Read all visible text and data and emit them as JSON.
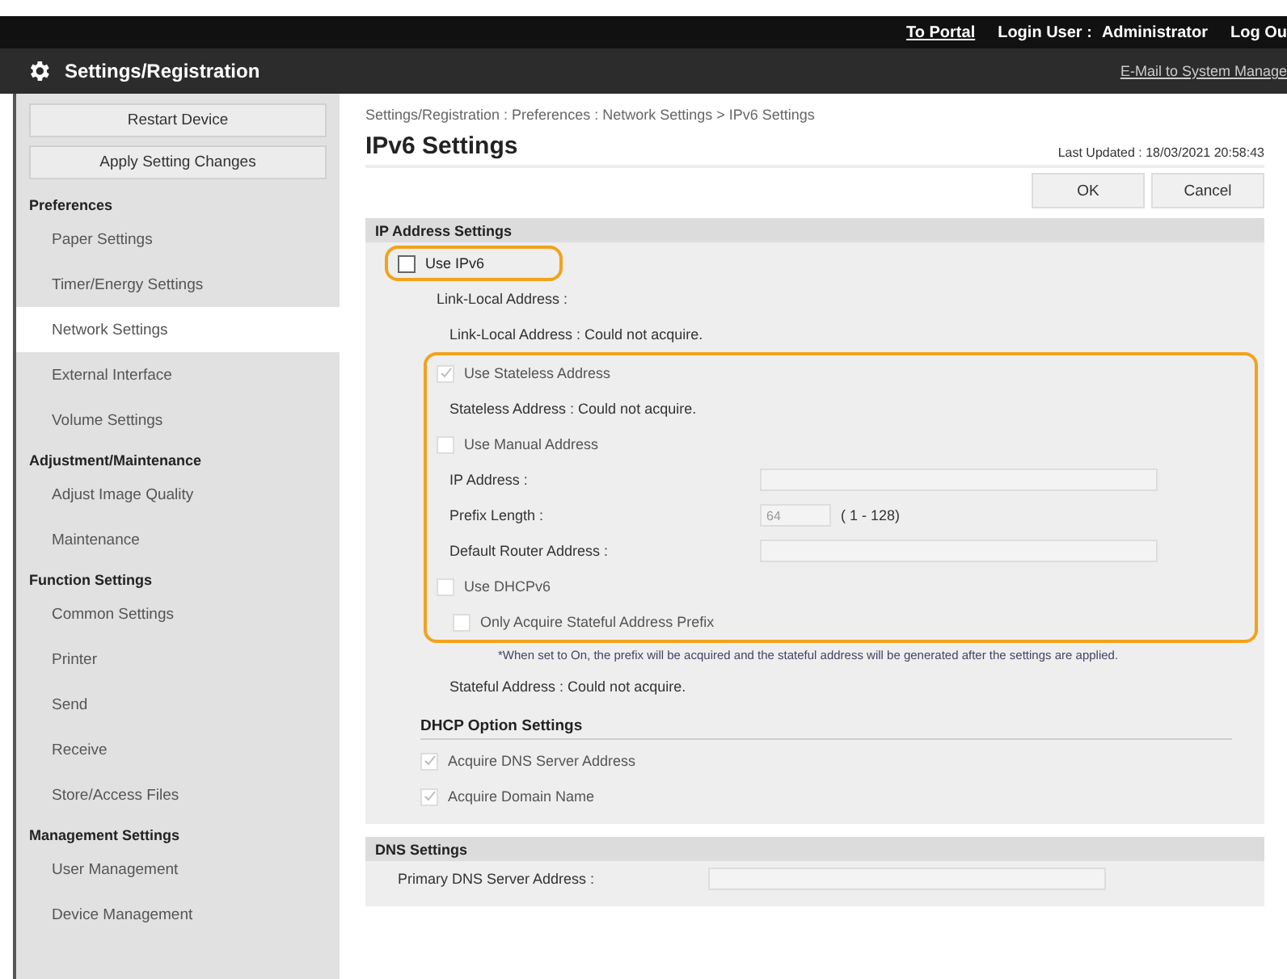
{
  "top_bar": {
    "links": [
      "To Portal"
    ],
    "login_label": "Login User :",
    "user": "Administrator",
    "logout": "Log Ou"
  },
  "header": {
    "title": "Settings/Registration",
    "mail_link": "E-Mail to System Manage"
  },
  "sidebar": {
    "buttons": [
      "Restart Device",
      "Apply Setting Changes"
    ],
    "groups": [
      {
        "title": "Preferences",
        "items": [
          {
            "label": "Paper Settings",
            "selected": false
          },
          {
            "label": "Timer/Energy Settings",
            "selected": false
          },
          {
            "label": "Network Settings",
            "selected": true
          },
          {
            "label": "External Interface",
            "selected": false
          },
          {
            "label": "Volume Settings",
            "selected": false
          }
        ]
      },
      {
        "title": "Adjustment/Maintenance",
        "items": [
          {
            "label": "Adjust Image Quality",
            "selected": false
          },
          {
            "label": "Maintenance",
            "selected": false
          }
        ]
      },
      {
        "title": "Function Settings",
        "items": [
          {
            "label": "Common Settings",
            "selected": false
          },
          {
            "label": "Printer",
            "selected": false
          },
          {
            "label": "Send",
            "selected": false
          },
          {
            "label": "Receive",
            "selected": false
          },
          {
            "label": "Store/Access Files",
            "selected": false
          }
        ]
      },
      {
        "title": "Management Settings",
        "items": [
          {
            "label": "User Management",
            "selected": false
          },
          {
            "label": "Device Management",
            "selected": false
          }
        ]
      }
    ]
  },
  "breadcrumb": "Settings/Registration : Preferences : Network Settings > IPv6 Settings",
  "page_title": "IPv6 Settings",
  "last_updated": "Last Updated : 18/03/2021 20:58:43",
  "buttons": [
    "OK",
    "Cancel"
  ],
  "ip_address_settings": {
    "title": "IP Address Settings",
    "use_ipv6": {
      "label": "Use IPv6",
      "checked": false,
      "disabled": false,
      "highlighted": true
    },
    "link_local_heading": "Link-Local Address :",
    "link_local_status": "Link-Local Address : Could not acquire.",
    "group_highlighted": true,
    "stateless": {
      "label": "Use Stateless Address",
      "checked": true,
      "disabled": true
    },
    "stateless_status": "Stateless Address : Could not acquire.",
    "manual": {
      "label": "Use Manual Address",
      "checked": false,
      "disabled": true
    },
    "manual_fields": [
      {
        "label": "IP Address :",
        "kind": "wide"
      },
      {
        "label": "Prefix Length :",
        "kind": "short",
        "value": "64",
        "hint": "( 1 - 128)"
      },
      {
        "label": "Default Router Address :",
        "kind": "wide"
      }
    ],
    "dhcpv6": {
      "label": "Use DHCPv6",
      "checked": false,
      "disabled": true
    },
    "only_stateful": {
      "label": "Only Acquire Stateful Address Prefix",
      "checked": false,
      "disabled": true
    },
    "note": "*When set to On, the prefix will be acquired and the stateful address will be generated after the settings are applied.",
    "stateful_status": "Stateful Address : Could not acquire.",
    "dhcp_options": {
      "title": "DHCP Option Settings",
      "items": [
        {
          "label": "Acquire DNS Server Address",
          "checked": true,
          "disabled": true
        },
        {
          "label": "Acquire Domain Name",
          "checked": true,
          "disabled": true
        }
      ]
    }
  },
  "dns_settings": {
    "title": "DNS Settings",
    "fields": [
      {
        "label": "Primary DNS Server Address :"
      }
    ]
  }
}
